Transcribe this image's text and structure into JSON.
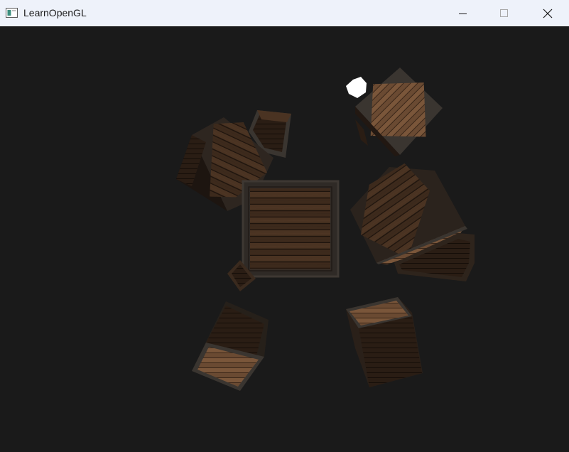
{
  "window": {
    "title": "LearnOpenGL",
    "icon": "app-window-icon",
    "controls": {
      "minimize": "minimize-icon",
      "maximize": "maximize-icon",
      "close": "close-icon"
    }
  },
  "scene": {
    "background": "#1a1a1a",
    "light_color": "#ffffff",
    "crate_dark": "#2a1d14",
    "crate_mid": "#4a3322",
    "crate_light": "#6a4a32",
    "crate_frame": "#3a3530"
  }
}
